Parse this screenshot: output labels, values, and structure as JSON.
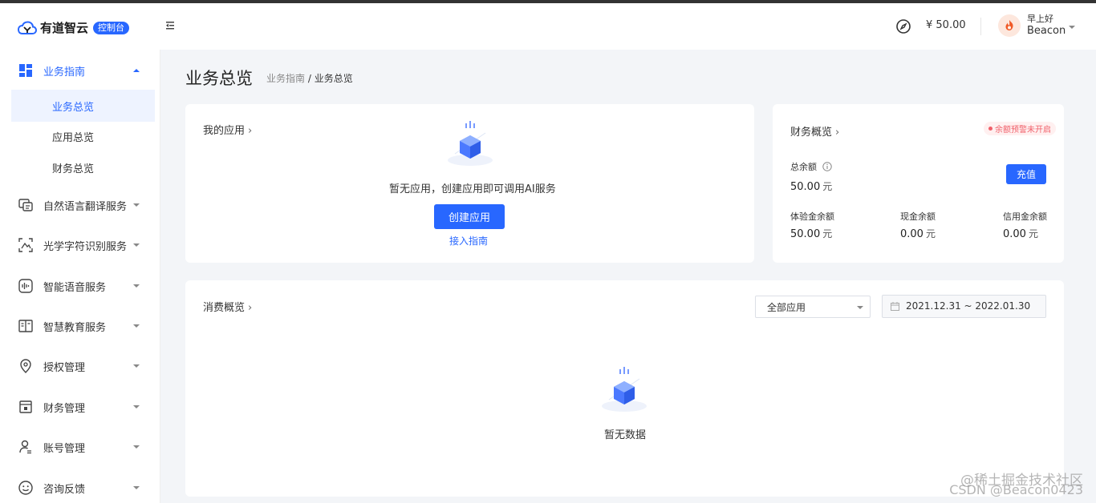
{
  "header": {
    "logo_text": "有道智云",
    "console_badge": "控制台",
    "balance": "¥ 50.00",
    "greeting": "早上好",
    "username": "Beacon"
  },
  "sidebar": {
    "items": [
      {
        "label": "业务指南",
        "icon": "grid-icon",
        "expanded": true
      },
      {
        "label": "业务总览",
        "sub": true,
        "active": true
      },
      {
        "label": "应用总览",
        "sub": true
      },
      {
        "label": "财务总览",
        "sub": true
      },
      {
        "label": "自然语言翻译服务",
        "icon": "translate-icon"
      },
      {
        "label": "光学字符识别服务",
        "icon": "ocr-icon"
      },
      {
        "label": "智能语音服务",
        "icon": "voice-icon"
      },
      {
        "label": "智慧教育服务",
        "icon": "book-icon"
      },
      {
        "label": "授权管理",
        "icon": "location-icon"
      },
      {
        "label": "财务管理",
        "icon": "wallet-icon"
      },
      {
        "label": "账号管理",
        "icon": "user-icon"
      },
      {
        "label": "咨询反馈",
        "icon": "smile-icon"
      }
    ]
  },
  "page": {
    "title": "业务总览",
    "breadcrumb_parent": "业务指南",
    "breadcrumb_sep": " / ",
    "breadcrumb_current": "业务总览"
  },
  "my_apps": {
    "title": "我的应用",
    "empty_text": "暂无应用，创建应用即可调用AI服务",
    "create_button": "创建应用",
    "guide_link": "接入指南"
  },
  "finance": {
    "title": "财务概览",
    "alert_tag": "余额预警未开启",
    "total_label": "总余额",
    "total_value": "50.00",
    "unit": "元",
    "recharge_button": "充值",
    "trial_label": "体验金余额",
    "trial_value": "50.00",
    "cash_label": "现金余额",
    "cash_value": "0.00",
    "credit_label": "信用金余额",
    "credit_value": "0.00"
  },
  "consumption": {
    "title": "消费概览",
    "app_select": "全部应用",
    "date_range": "2021.12.31 ~ 2022.01.30",
    "empty_text": "暂无数据"
  },
  "watermark": {
    "line1": "@稀土掘金技术社区",
    "line2": "CSDN @Beacon0423"
  },
  "colors": {
    "primary": "#2867ff",
    "alert": "#f0606a"
  }
}
